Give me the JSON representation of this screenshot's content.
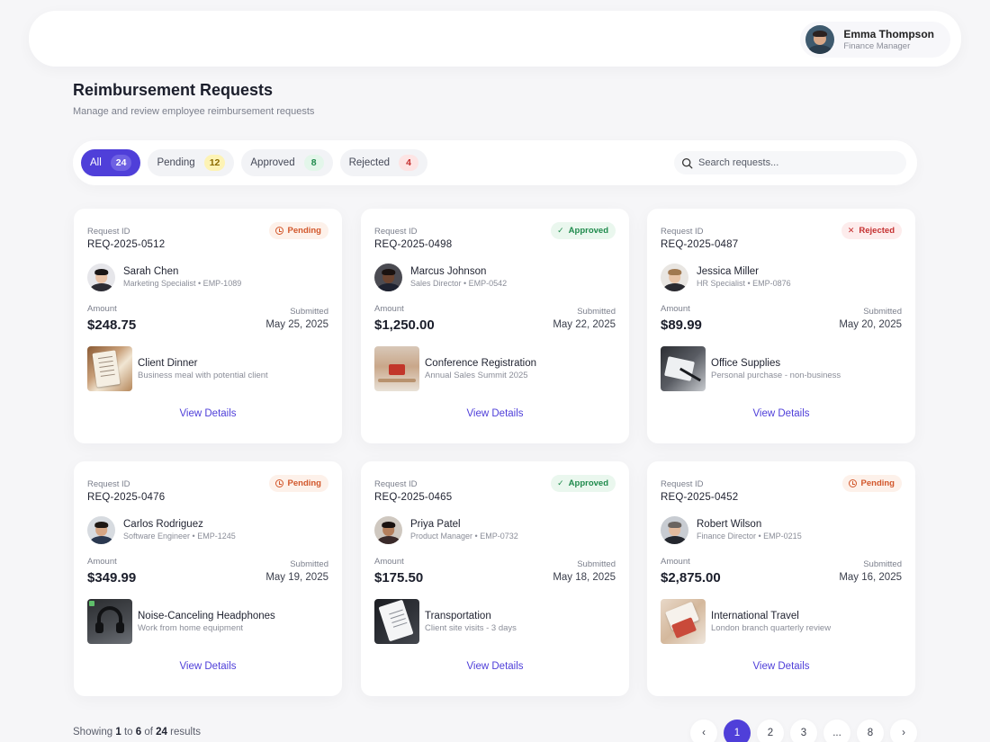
{
  "user": {
    "name": "Emma Thompson",
    "role": "Finance Manager"
  },
  "page": {
    "title": "Reimbursement Requests",
    "subtitle": "Manage and review employee reimbursement requests"
  },
  "filters": {
    "tabs": [
      {
        "label": "All",
        "count": "24"
      },
      {
        "label": "Pending",
        "count": "12"
      },
      {
        "label": "Approved",
        "count": "8"
      },
      {
        "label": "Rejected",
        "count": "4"
      }
    ],
    "search_placeholder": "Search requests..."
  },
  "labels": {
    "request_id": "Request ID",
    "amount": "Amount",
    "submitted": "Submitted",
    "view_details": "View Details"
  },
  "requests": [
    {
      "id": "REQ-2025-0512",
      "status": "Pending",
      "name": "Sarah Chen",
      "meta": "Marketing Specialist • EMP-1089",
      "amount": "$248.75",
      "date": "May 25, 2025",
      "title": "Client Dinner",
      "desc": "Business meal with potential client"
    },
    {
      "id": "REQ-2025-0498",
      "status": "Approved",
      "name": "Marcus Johnson",
      "meta": "Sales Director • EMP-0542",
      "amount": "$1,250.00",
      "date": "May 22, 2025",
      "title": "Conference Registration",
      "desc": "Annual Sales Summit 2025"
    },
    {
      "id": "REQ-2025-0487",
      "status": "Rejected",
      "name": "Jessica Miller",
      "meta": "HR Specialist • EMP-0876",
      "amount": "$89.99",
      "date": "May 20, 2025",
      "title": "Office Supplies",
      "desc": "Personal purchase - non-business"
    },
    {
      "id": "REQ-2025-0476",
      "status": "Pending",
      "name": "Carlos Rodriguez",
      "meta": "Software Engineer • EMP-1245",
      "amount": "$349.99",
      "date": "May 19, 2025",
      "title": "Noise-Canceling Headphones",
      "desc": "Work from home equipment"
    },
    {
      "id": "REQ-2025-0465",
      "status": "Approved",
      "name": "Priya Patel",
      "meta": "Product Manager • EMP-0732",
      "amount": "$175.50",
      "date": "May 18, 2025",
      "title": "Transportation",
      "desc": "Client site visits - 3 days"
    },
    {
      "id": "REQ-2025-0452",
      "status": "Pending",
      "name": "Robert Wilson",
      "meta": "Finance Director • EMP-0215",
      "amount": "$2,875.00",
      "date": "May 16, 2025",
      "title": "International Travel",
      "desc": "London branch quarterly review"
    }
  ],
  "pagination": {
    "showing_prefix": "Showing",
    "from": "1",
    "to_word": "to",
    "to": "6",
    "of_word": "of",
    "total": "24",
    "suffix": "results",
    "pages": [
      "1",
      "2",
      "3",
      "...",
      "8"
    ],
    "prev": "‹",
    "next": "›"
  },
  "colors": {
    "accent": "#4f3fd9",
    "pending": "#d2572b",
    "approved": "#1f8a4c",
    "rejected": "#c53030"
  }
}
